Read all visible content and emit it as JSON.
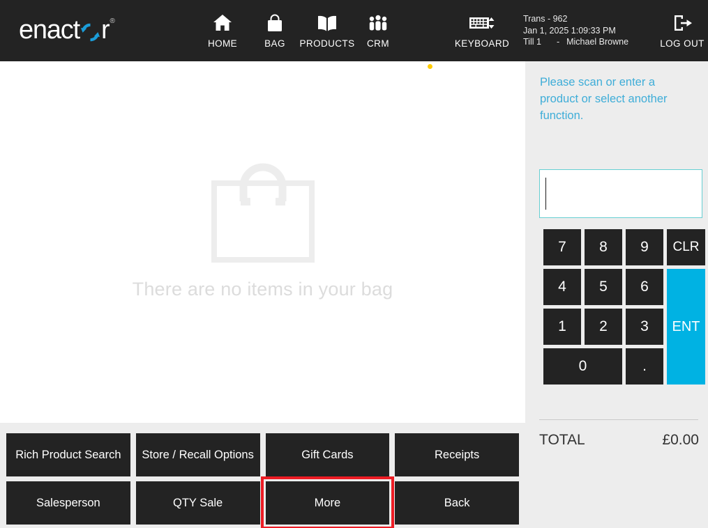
{
  "brand": {
    "name_before": "enact",
    "name_after": "r",
    "logo_icon": "refresh-circular-arrows-icon",
    "trademark": "®",
    "accent_blue": "#1b9dd9"
  },
  "header": {
    "nav": [
      {
        "label": "HOME",
        "icon": "home-icon"
      },
      {
        "label": "BAG",
        "icon": "shopping-bag-icon"
      },
      {
        "label": "PRODUCTS",
        "icon": "open-book-icon"
      },
      {
        "label": "CRM",
        "icon": "people-group-icon"
      }
    ],
    "keyboard": {
      "label": "KEYBOARD",
      "icon": "keyboard-icon"
    },
    "logout": {
      "label": "LOG OUT",
      "icon": "logout-arrow-icon"
    },
    "transaction": {
      "trans": "Trans - 962",
      "datetime": "Jan 1, 2025 1:09:33 PM",
      "till": "Till 1",
      "separator": "-",
      "operator": "Michael Browne"
    },
    "background": "#232323"
  },
  "bag_panel": {
    "status_dot_color": "#ffcc00",
    "status_dot": "status-dot-indicator",
    "bag_icon": "empty-shopping-bag-outline-icon",
    "empty_message": "There are no items in your bag"
  },
  "function_buttons": [
    {
      "label": "Rich Product Search",
      "highlighted": false
    },
    {
      "label": "Store / Recall Options",
      "highlighted": false
    },
    {
      "label": "Gift Cards",
      "highlighted": false
    },
    {
      "label": "Receipts",
      "highlighted": false
    },
    {
      "label": "Salesperson",
      "highlighted": false
    },
    {
      "label": "QTY Sale",
      "highlighted": false
    },
    {
      "label": "More",
      "highlighted": true
    },
    {
      "label": "Back",
      "highlighted": false
    }
  ],
  "highlight_color": "#ed1c24",
  "sidebar": {
    "prompt": "Please scan or enter a product or select another function.",
    "scan_input": {
      "value": "",
      "placeholder": "",
      "border_color": "#66cfd2"
    },
    "keypad": [
      {
        "label": "7",
        "type": "digit"
      },
      {
        "label": "8",
        "type": "digit"
      },
      {
        "label": "9",
        "type": "digit"
      },
      {
        "label": "CLR",
        "type": "clear"
      },
      {
        "label": "4",
        "type": "digit"
      },
      {
        "label": "5",
        "type": "digit"
      },
      {
        "label": "6",
        "type": "digit"
      },
      {
        "label": "1",
        "type": "digit"
      },
      {
        "label": "2",
        "type": "digit"
      },
      {
        "label": "3",
        "type": "digit"
      },
      {
        "label": "ENT",
        "type": "enter"
      },
      {
        "label": "0",
        "type": "digit-wide"
      },
      {
        "label": ".",
        "type": "decimal"
      }
    ],
    "enter_key_color": "#00b2e3",
    "total": {
      "label": "TOTAL",
      "value": "£0.00"
    }
  }
}
